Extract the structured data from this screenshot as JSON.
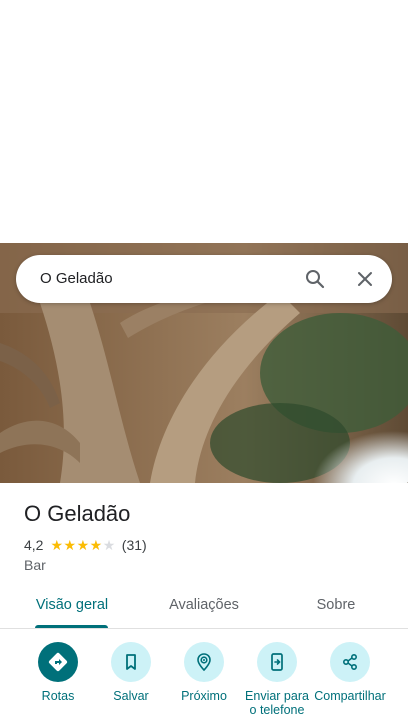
{
  "search": {
    "query": "O Geladão"
  },
  "place": {
    "name": "O Geladão",
    "rating": "4,2",
    "stars": 4,
    "max_stars": 5,
    "review_count": "(31)",
    "category": "Bar"
  },
  "tabs": [
    {
      "label": "Visão geral",
      "active": true
    },
    {
      "label": "Avaliações",
      "active": false
    },
    {
      "label": "Sobre",
      "active": false
    }
  ],
  "actions": [
    {
      "label": "Rotas",
      "icon": "directions-icon"
    },
    {
      "label": "Salvar",
      "icon": "bookmark-icon"
    },
    {
      "label": "Próximo",
      "icon": "nearby-icon"
    },
    {
      "label": "Enviar para o telefone",
      "icon": "send-to-phone-icon"
    },
    {
      "label": "Compartilhar",
      "icon": "share-icon"
    }
  ],
  "colors": {
    "accent": "#00707a",
    "action_bg": "#cdf2f7",
    "star": "#fbbc04"
  }
}
